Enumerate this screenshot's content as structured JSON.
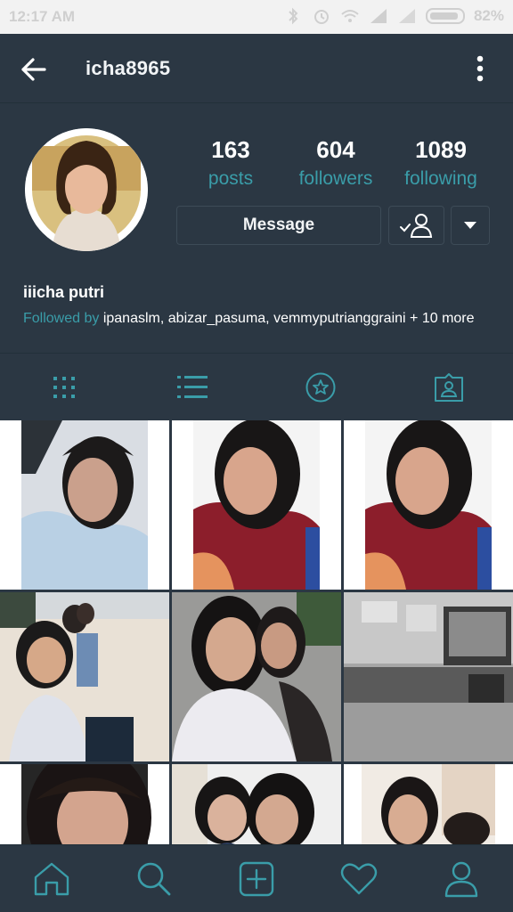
{
  "status_bar": {
    "time": "12:17 AM",
    "battery_percent": "82%"
  },
  "header": {
    "username": "icha8965",
    "back_icon": "arrow-left-icon",
    "menu_icon": "more-vertical-icon"
  },
  "profile": {
    "full_name": "iiicha putri",
    "stats": [
      {
        "number": "163",
        "label": "posts"
      },
      {
        "number": "604",
        "label": "followers"
      },
      {
        "number": "1089",
        "label": "following"
      }
    ],
    "message_button": "Message",
    "followed_by_prefix": "Followed by",
    "followed_by_users": [
      "ipanaslm",
      "abizar_pasuma",
      "vemmyputrianggraini"
    ],
    "followed_by_more": "+ 10 more"
  },
  "tabs": [
    {
      "icon": "grid-icon"
    },
    {
      "icon": "list-icon"
    },
    {
      "icon": "star-circle-icon"
    },
    {
      "icon": "tagged-person-icon"
    }
  ],
  "bottom_nav": [
    {
      "icon": "home-icon"
    },
    {
      "icon": "search-icon"
    },
    {
      "icon": "add-post-icon"
    },
    {
      "icon": "heart-icon"
    },
    {
      "icon": "profile-icon"
    }
  ],
  "colors": {
    "background": "#2b3743",
    "accent": "#3a9da9",
    "text": "#ffffff"
  }
}
